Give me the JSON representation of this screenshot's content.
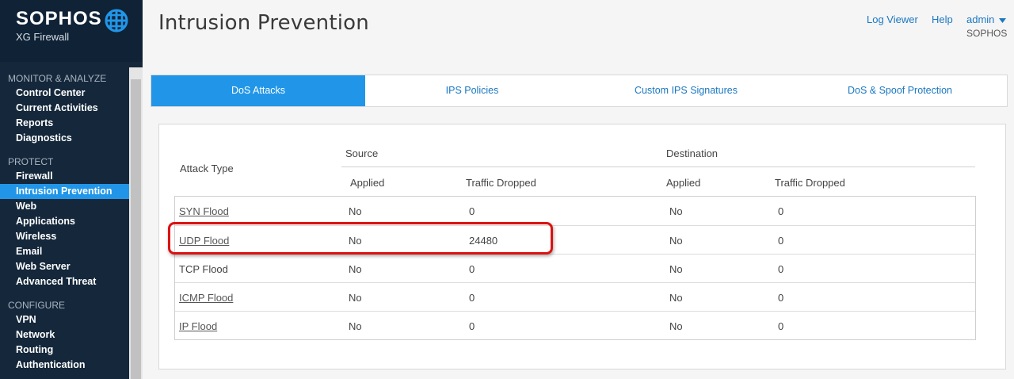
{
  "brand": {
    "name": "SOPHOS",
    "product": "XG Firewall"
  },
  "sidebar": {
    "sections": [
      {
        "title": "MONITOR & ANALYZE",
        "items": [
          "Control Center",
          "Current Activities",
          "Reports",
          "Diagnostics"
        ]
      },
      {
        "title": "PROTECT",
        "items": [
          "Firewall",
          "Intrusion Prevention",
          "Web",
          "Applications",
          "Wireless",
          "Email",
          "Web Server",
          "Advanced Threat"
        ]
      },
      {
        "title": "CONFIGURE",
        "items": [
          "VPN",
          "Network",
          "Routing",
          "Authentication"
        ]
      }
    ],
    "active_item": "Intrusion Prevention"
  },
  "header": {
    "title": "Intrusion Prevention",
    "log_viewer": "Log Viewer",
    "help": "Help",
    "user": "admin",
    "user_dropdown_icon": "caret-down-icon",
    "org": "SOPHOS"
  },
  "tabs": [
    {
      "label": "DoS Attacks",
      "active": true
    },
    {
      "label": "IPS Policies",
      "active": false
    },
    {
      "label": "Custom IPS Signatures",
      "active": false
    },
    {
      "label": "DoS & Spoof Protection",
      "active": false
    }
  ],
  "table": {
    "attack_type_header": "Attack Type",
    "source_header": "Source",
    "destination_header": "Destination",
    "applied_header": "Applied",
    "traffic_dropped_header": "Traffic Dropped",
    "rows": [
      {
        "attack": "SYN Flood",
        "link": true,
        "src_applied": "No",
        "src_dropped": "0",
        "dst_applied": "No",
        "dst_dropped": "0"
      },
      {
        "attack": "UDP Flood",
        "link": true,
        "src_applied": "No",
        "src_dropped": "24480",
        "dst_applied": "No",
        "dst_dropped": "0"
      },
      {
        "attack": "TCP Flood",
        "link": false,
        "src_applied": "No",
        "src_dropped": "0",
        "dst_applied": "No",
        "dst_dropped": "0"
      },
      {
        "attack": "ICMP Flood",
        "link": true,
        "src_applied": "No",
        "src_dropped": "0",
        "dst_applied": "No",
        "dst_dropped": "0"
      },
      {
        "attack": "IP Flood",
        "link": true,
        "src_applied": "No",
        "src_dropped": "0",
        "dst_applied": "No",
        "dst_dropped": "0"
      }
    ]
  },
  "colors": {
    "accent": "#2196e8",
    "sidebar": "#14273b",
    "highlight": "#dd1111"
  }
}
